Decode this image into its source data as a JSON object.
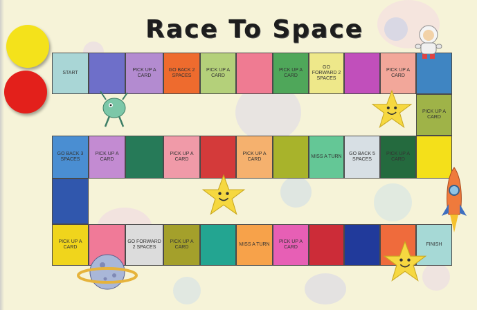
{
  "title": "Race To Space",
  "counters": [
    {
      "name": "yellow-counter",
      "color": "#f4e21b"
    },
    {
      "name": "red-counter",
      "color": "#e3201b"
    }
  ],
  "rows": [
    [
      {
        "label": "START",
        "color": "#a9d6d6"
      },
      {
        "label": "",
        "color": "#6e6fc9"
      },
      {
        "label": "PICK UP A CARD",
        "color": "#b38bd0"
      },
      {
        "label": "GO BACK 2 SPACES",
        "color": "#ee6b2e"
      },
      {
        "label": "PICK UP A CARD",
        "color": "#b4d07a"
      },
      {
        "label": "",
        "color": "#ef7b92"
      },
      {
        "label": "PICK UP A CARD",
        "color": "#4fa75a"
      },
      {
        "label": "GO FORWARD 2 SPACES",
        "color": "#eee88a"
      },
      {
        "label": "",
        "color": "#c14fbb"
      },
      {
        "label": "PICK UP A CARD",
        "color": "#f2a79a"
      },
      {
        "label": "",
        "color": "#3f85c2"
      }
    ],
    [
      {
        "label": "PICK UP A CARD",
        "color": "#9fb348"
      }
    ],
    [
      {
        "label": "GO BACK 3 SPACES",
        "color": "#4a8ed2"
      },
      {
        "label": "PICK UP A CARD",
        "color": "#c38bd2"
      },
      {
        "label": "",
        "color": "#267a58"
      },
      {
        "label": "PICK UP A CARD",
        "color": "#f09aa8"
      },
      {
        "label": "",
        "color": "#d43a3a"
      },
      {
        "label": "PICK UP A CARD",
        "color": "#f5b16e"
      },
      {
        "label": "",
        "color": "#a8b32b"
      },
      {
        "label": "MISS A TURN",
        "color": "#64c796"
      },
      {
        "label": "GO BACK 5 SPACES",
        "color": "#d7dfe4"
      },
      {
        "label": "PICK UP A CARD",
        "color": "#246a3e"
      },
      {
        "label": "",
        "color": "#f4e01a"
      }
    ],
    [
      {
        "label": "",
        "color": "#3057ad"
      }
    ],
    [
      {
        "label": "PICK UP A CARD",
        "color": "#f0d51c"
      },
      {
        "label": "",
        "color": "#f07a98"
      },
      {
        "label": "GO FORWARD 2 SPACES",
        "color": "#dcdcdc"
      },
      {
        "label": "PICK UP A CARD",
        "color": "#a4a02b"
      },
      {
        "label": "",
        "color": "#23a591"
      },
      {
        "label": "MISS A TURN",
        "color": "#f7a24a"
      },
      {
        "label": "PICK UP A CARD",
        "color": "#e75fb5"
      },
      {
        "label": "",
        "color": "#cc2c38"
      },
      {
        "label": "",
        "color": "#213a9b"
      },
      {
        "label": "",
        "color": "#ef6b3c"
      },
      {
        "label": "FINISH",
        "color": "#a6d9d6"
      }
    ]
  ]
}
